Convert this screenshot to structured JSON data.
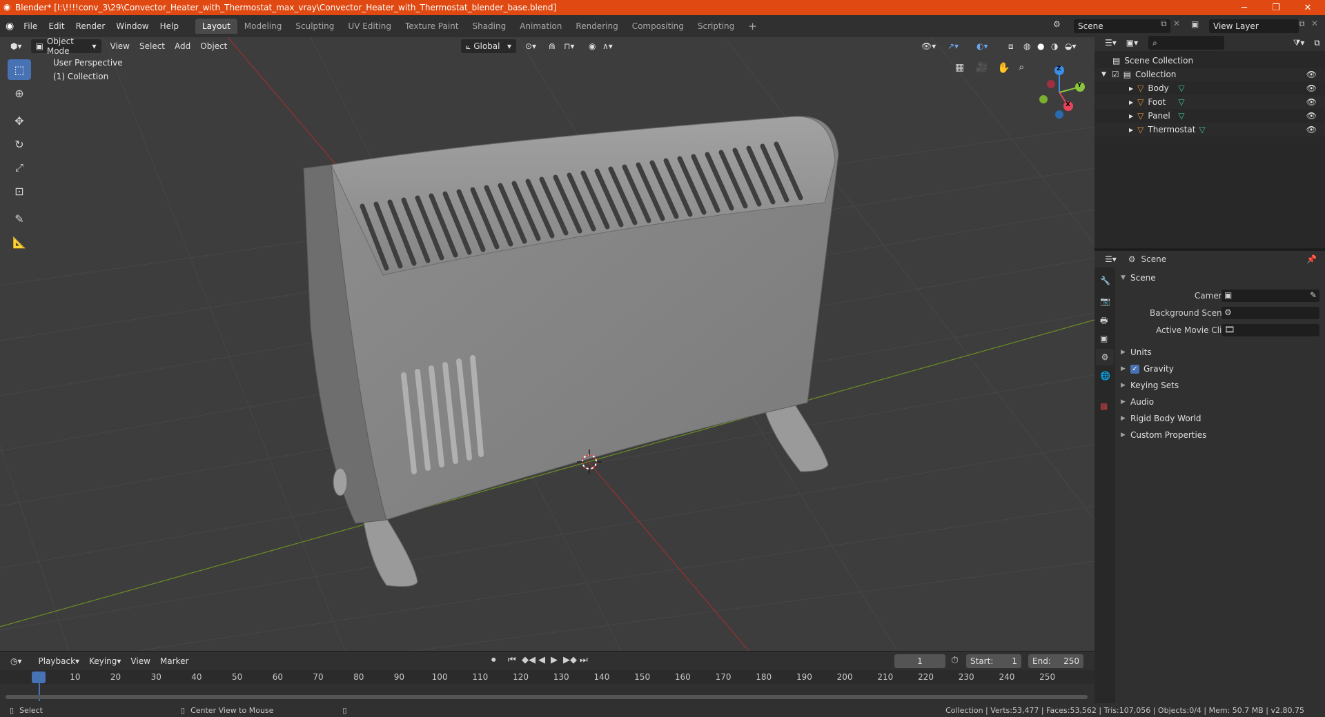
{
  "window": {
    "title": "Blender* [I:\\!!!!conv_3\\29\\Convector_Heater_with_Thermostat_max_vray\\Convector_Heater_with_Thermostat_blender_base.blend]",
    "minimize": "─",
    "restore": "❐",
    "close": "✕"
  },
  "menu": [
    "File",
    "Edit",
    "Render",
    "Window",
    "Help"
  ],
  "workspaces": [
    {
      "label": "Layout",
      "active": true
    },
    {
      "label": "Modeling"
    },
    {
      "label": "Sculpting"
    },
    {
      "label": "UV Editing"
    },
    {
      "label": "Texture Paint"
    },
    {
      "label": "Shading"
    },
    {
      "label": "Animation"
    },
    {
      "label": "Rendering"
    },
    {
      "label": "Compositing"
    },
    {
      "label": "Scripting"
    }
  ],
  "scene_field": "Scene",
  "view_layer_field": "View Layer",
  "viewport": {
    "mode": "Object Mode",
    "menus": [
      "View",
      "Select",
      "Add",
      "Object"
    ],
    "transform_orientation": "Global",
    "overlay_title": "User Perspective",
    "overlay_collection": "(1) Collection",
    "gizmo_axes": {
      "x": "X",
      "y": "Y",
      "z": "Z"
    }
  },
  "timeline": {
    "menus": [
      "Playback",
      "Keying",
      "View",
      "Marker"
    ],
    "current_frame": "1",
    "start_label": "Start:",
    "start": "1",
    "end_label": "End:",
    "end": "250",
    "ticks": [
      "1",
      "10",
      "20",
      "30",
      "40",
      "50",
      "60",
      "70",
      "80",
      "90",
      "100",
      "110",
      "120",
      "130",
      "140",
      "150",
      "160",
      "170",
      "180",
      "190",
      "200",
      "210",
      "220",
      "230",
      "240",
      "250"
    ]
  },
  "statusbar": {
    "select": "Select",
    "center_view": "Center View to Mouse",
    "stats": "Collection | Verts:53,477 | Faces:53,562 | Tris:107,056 | Objects:0/4 | Mem: 50.7 MB | v2.80.75"
  },
  "outliner": {
    "root": "Scene Collection",
    "collection": "Collection",
    "objects": [
      "Body",
      "Foot",
      "Panel",
      "Thermostat"
    ]
  },
  "properties": {
    "context": "Scene",
    "panel_title": "Scene",
    "camera_label": "Camera",
    "background_scene_label": "Background Scene",
    "active_movie_clip_label": "Active Movie Clip",
    "subpanels": [
      "Units",
      "Gravity",
      "Keying Sets",
      "Audio",
      "Rigid Body World",
      "Custom Properties"
    ]
  },
  "colors": {
    "title_bar": "#e04a12",
    "accent": "#4772b3",
    "object_icon": "#e8913a",
    "mesh_icon": "#3fc2a0",
    "x_axis": "#e8435a",
    "y_axis": "#8cc63e",
    "z_axis": "#3a8ee8"
  }
}
